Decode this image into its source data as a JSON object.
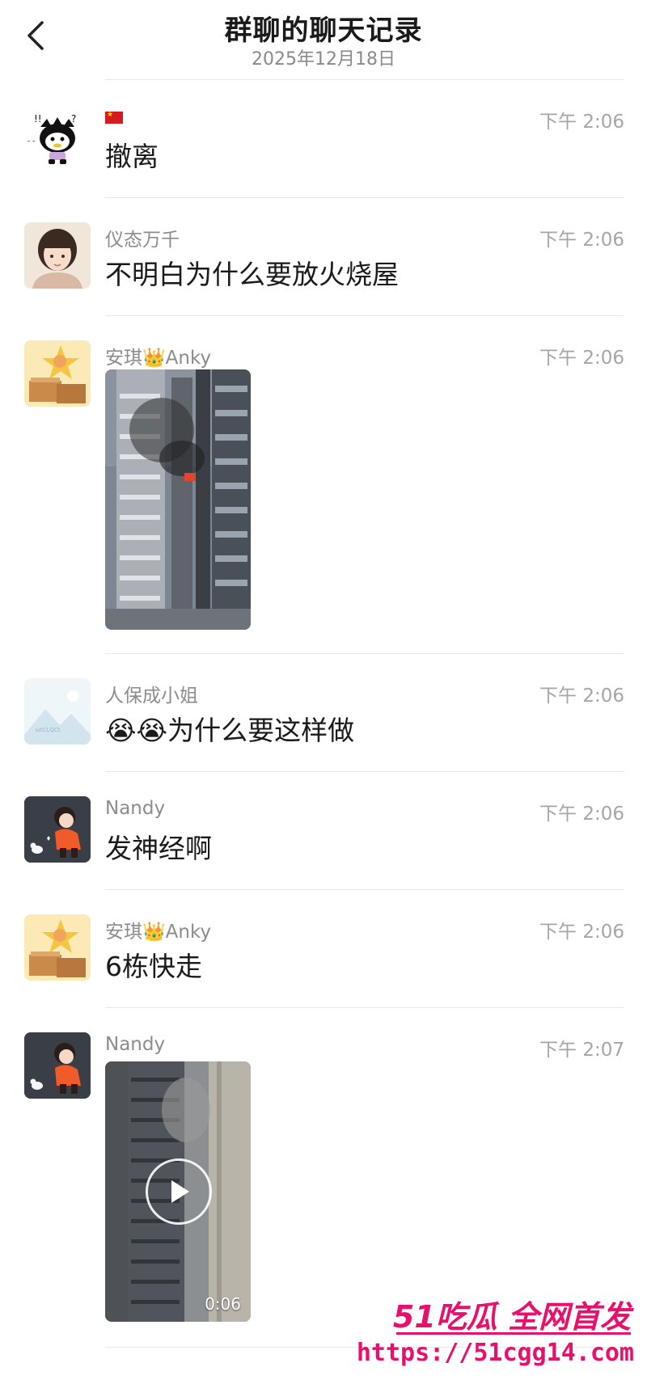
{
  "header": {
    "title": "群聊的聊天记录",
    "subtitle": "2025年12月18日"
  },
  "messages": [
    {
      "sender": "",
      "time": "下午 2:06",
      "text": "撤离",
      "type": "text",
      "avatar": "badtz-maru-avatar"
    },
    {
      "sender": "仪态万千",
      "time": "下午 2:06",
      "text": "不明白为什么要放火烧屋",
      "type": "text",
      "avatar": "girl-portrait-avatar"
    },
    {
      "sender": "安琪👑Anky",
      "time": "下午 2:06",
      "text": "",
      "type": "image",
      "avatar": "star-doll-avatar"
    },
    {
      "sender": "人保成小姐",
      "time": "下午 2:06",
      "text": "😭😭为什么要这样做",
      "type": "text",
      "avatar": "landscape-placeholder-avatar"
    },
    {
      "sender": "Nandy",
      "time": "下午 2:06",
      "text": "发神经啊",
      "type": "text",
      "avatar": "cartoon-girl-dog-avatar"
    },
    {
      "sender": "安琪👑Anky",
      "time": "下午 2:06",
      "text": "6栋快走",
      "type": "text",
      "avatar": "star-doll-avatar"
    },
    {
      "sender": "Nandy",
      "time": "下午 2:07",
      "text": "",
      "type": "video",
      "duration": "0:06",
      "avatar": "cartoon-girl-dog-avatar"
    }
  ],
  "watermark": {
    "brand": "51吃瓜 全网首发",
    "url": "https://51cgg14.com"
  },
  "colors": {
    "watermark": "#e8106c",
    "text": "#1a1a1a",
    "meta": "#8c8c8c"
  }
}
